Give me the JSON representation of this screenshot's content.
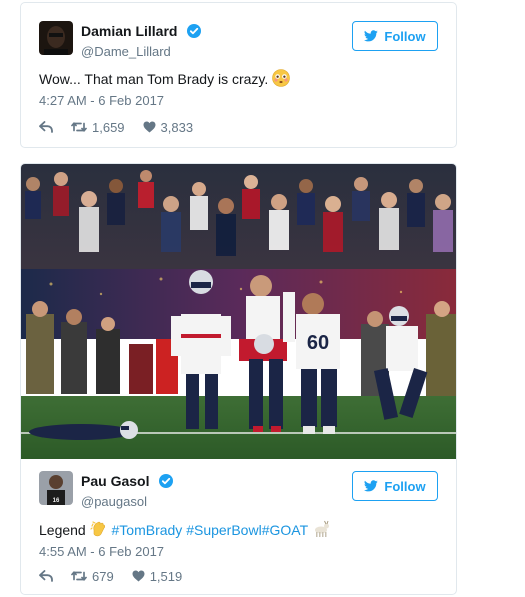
{
  "tweets": [
    {
      "display_name": "Damian Lillard",
      "handle": "@Dame_Lillard",
      "follow_label": "Follow",
      "text": "Wow... That man Tom Brady is crazy.",
      "timestamp": "4:27 AM - 6 Feb 2017",
      "retweets": "1,659",
      "likes": "3,833"
    },
    {
      "display_name": "Pau Gasol",
      "handle": "@paugasol",
      "follow_label": "Follow",
      "text_prefix": "Legend",
      "hashtags": [
        "#TomBrady",
        "#SuperBowl",
        "#GOAT"
      ],
      "timestamp": "4:55 AM - 6 Feb 2017",
      "retweets": "679",
      "likes": "1,519",
      "photo_jersey_numbers": [
        "60"
      ]
    }
  ],
  "colors": {
    "twitter_blue": "#1da1f2",
    "hashtag_blue": "#1b95e0",
    "meta_gray": "#657786",
    "border": "#e1e8ed"
  },
  "icons": [
    "verified-badge-icon",
    "twitter-bird-icon",
    "reply-icon",
    "retweet-icon",
    "heart-icon",
    "flushed-face-emoji",
    "clapping-hands-emoji",
    "goat-emoji"
  ]
}
